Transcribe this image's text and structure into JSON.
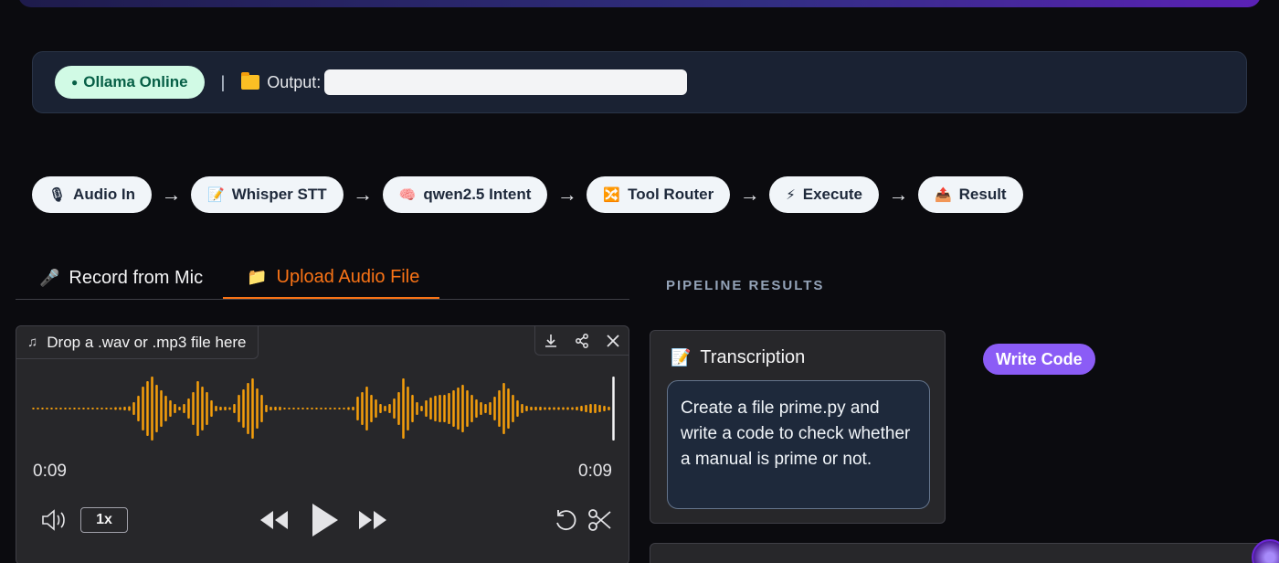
{
  "status": {
    "ollama_label": "Ollama Online",
    "separator": "|",
    "output_label": "Output:",
    "output_value": ""
  },
  "pipeline": [
    {
      "icon": "🎙",
      "icon_name": "microphone-icon",
      "label": "Audio In"
    },
    {
      "icon": "📝",
      "icon_name": "memo-icon",
      "label": "Whisper STT"
    },
    {
      "icon": "🧠",
      "icon_name": "brain-icon",
      "label": "qwen2.5 Intent"
    },
    {
      "icon": "🔀",
      "icon_name": "shuffle-icon",
      "label": "Tool Router"
    },
    {
      "icon": "⚡",
      "icon_name": "lightning-icon",
      "label": "Execute"
    },
    {
      "icon": "📤",
      "icon_name": "outbox-icon",
      "label": "Result"
    }
  ],
  "arrow": "→",
  "tabs": [
    {
      "icon": "🎤",
      "label": "Record from Mic",
      "active": false
    },
    {
      "icon": "📁",
      "label": "Upload Audio File",
      "active": true
    }
  ],
  "player": {
    "drop_label": "Drop a .wav or .mp3 file here",
    "time_current": "0:09",
    "time_total": "0:09",
    "rate": "1x"
  },
  "results": {
    "section_title": "PIPELINE RESULTS",
    "transcription_title": "Transcription",
    "transcription_text": "Create a file prime.py and write a code to check whether a manual is prime or not.",
    "intent_badge": "Write Code"
  },
  "colors": {
    "accent": "#f97316",
    "intent": "#8b5cf6",
    "online": "#d1fae5"
  }
}
